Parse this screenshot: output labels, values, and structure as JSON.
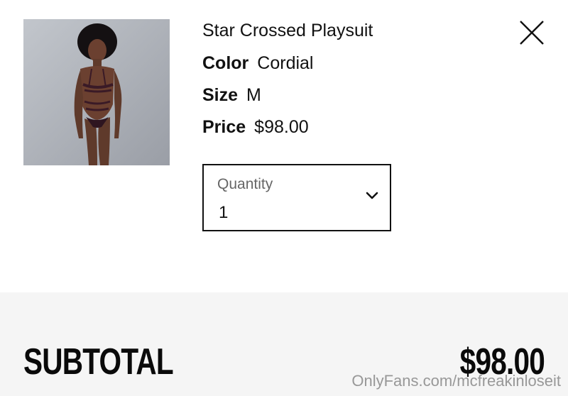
{
  "product": {
    "name": "Star Crossed Playsuit",
    "color_label": "Color",
    "color_value": "Cordial",
    "size_label": "Size",
    "size_value": "M",
    "price_label": "Price",
    "price_value": "$98.00",
    "image_icon": "product-photo"
  },
  "quantity": {
    "label": "Quantity",
    "value": "1",
    "icon": "chevron-down-icon"
  },
  "close": {
    "icon": "close-icon"
  },
  "footer": {
    "subtotal_label": "SUBTOTAL",
    "subtotal_value": "$98.00"
  },
  "watermark": "OnlyFans.com/mcfreakinloseit"
}
